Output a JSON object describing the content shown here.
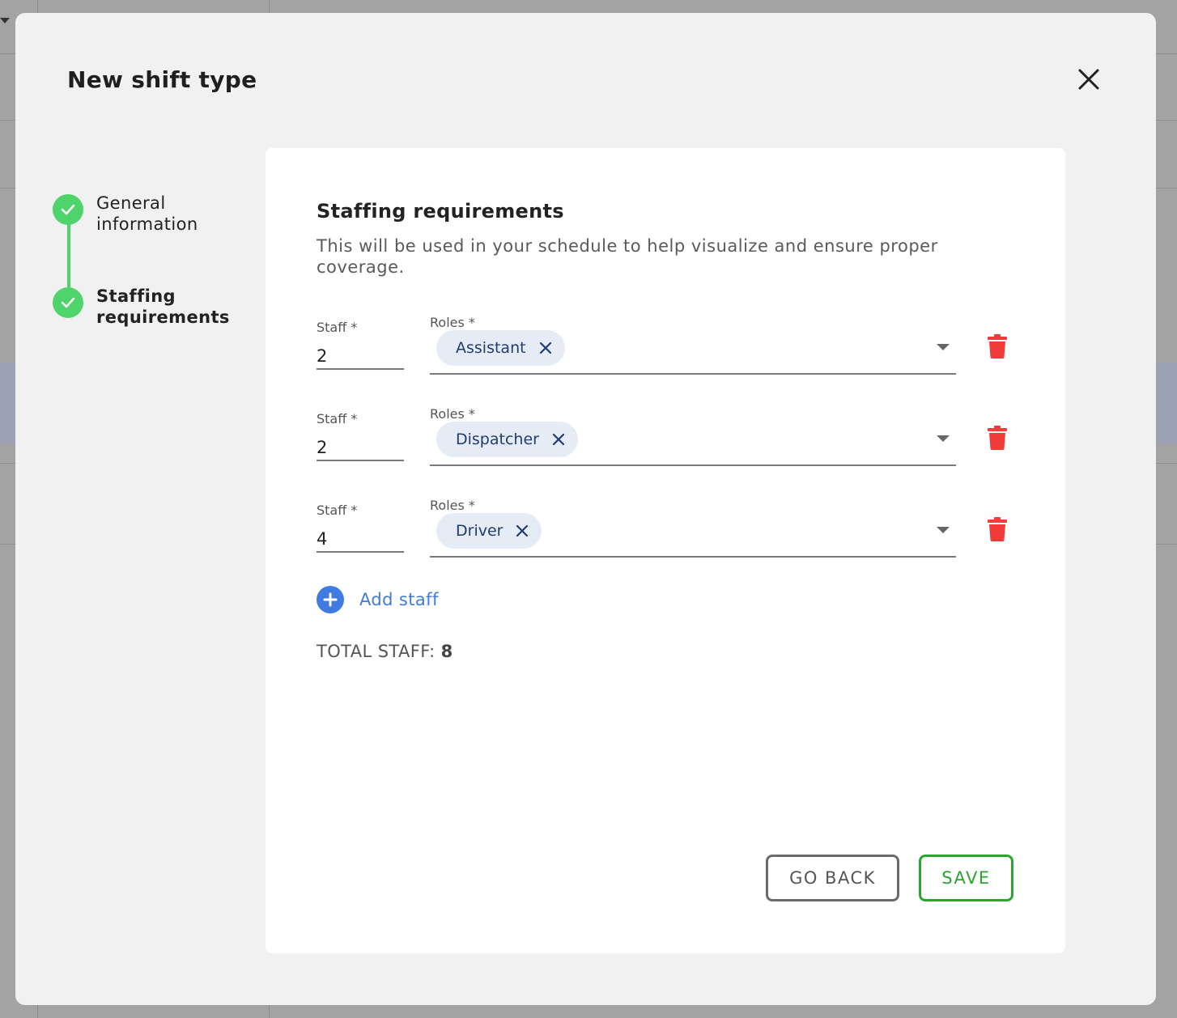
{
  "dialog": {
    "title": "New shift type"
  },
  "stepper": {
    "steps": [
      {
        "label": "General information",
        "state": "completed",
        "active": false
      },
      {
        "label": "Staffing requirements",
        "state": "completed",
        "active": true
      }
    ]
  },
  "section": {
    "title": "Staffing requirements",
    "description": "This will be used in your schedule to help visualize and ensure proper coverage."
  },
  "rows": [
    {
      "staff_label": "Staff *",
      "staff_value": "2",
      "roles_label": "Roles *",
      "role": "Assistant"
    },
    {
      "staff_label": "Staff *",
      "staff_value": "2",
      "roles_label": "Roles *",
      "role": "Dispatcher"
    },
    {
      "staff_label": "Staff *",
      "staff_value": "4",
      "roles_label": "Roles *",
      "role": "Driver"
    }
  ],
  "add_staff_label": "Add staff",
  "total": {
    "label": "TOTAL STAFF:",
    "value": "8"
  },
  "buttons": {
    "back": "GO BACK",
    "save": "SAVE"
  },
  "colors": {
    "step_complete": "#4ed46a",
    "link_blue": "#3f7be0",
    "delete_red": "#f23b3b",
    "save_green": "#2aa52e"
  }
}
